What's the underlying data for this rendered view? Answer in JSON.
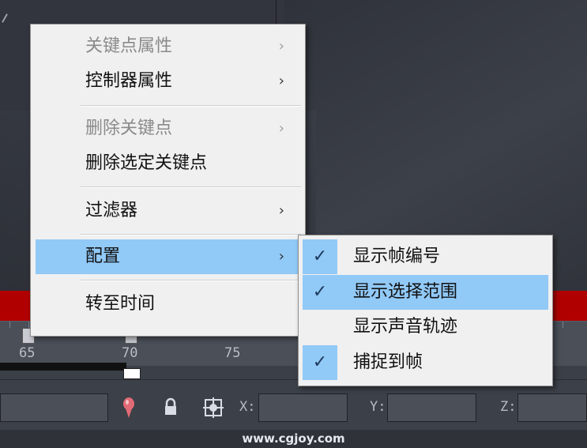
{
  "menu": {
    "items": [
      {
        "label": "关键点属性",
        "arrow": "›",
        "disabled": true
      },
      {
        "label": "控制器属性",
        "arrow": "›",
        "disabled": false
      },
      {
        "label": "删除关键点",
        "arrow": "›",
        "disabled": true
      },
      {
        "label": "删除选定关键点",
        "arrow": "",
        "disabled": false
      },
      {
        "label": "过滤器",
        "arrow": "›",
        "disabled": false
      },
      {
        "label": "配置",
        "arrow": "›",
        "disabled": false,
        "highlighted": true
      },
      {
        "label": "转至时间",
        "arrow": "",
        "disabled": false
      }
    ]
  },
  "submenu": {
    "items": [
      {
        "label": "显示帧编号",
        "checked": true
      },
      {
        "label": "显示选择范围",
        "checked": true,
        "highlighted": true
      },
      {
        "label": "显示声音轨迹",
        "checked": false
      },
      {
        "label": "捕捉到帧",
        "checked": true
      }
    ],
    "check_glyph": "✓"
  },
  "timeline": {
    "labels": [
      "65",
      "70",
      "75"
    ]
  },
  "statusbar": {
    "x_label": "X:",
    "y_label": "Y:",
    "z_label": "Z:",
    "icons": [
      "key-pin-icon",
      "lock-icon",
      "snap-target-icon"
    ]
  },
  "footer": {
    "watermark": "www.cgjoy.com"
  },
  "colors": {
    "highlight": "#91c9f7",
    "menu_bg": "#f0f0f0",
    "red_bar": "#b00000"
  }
}
